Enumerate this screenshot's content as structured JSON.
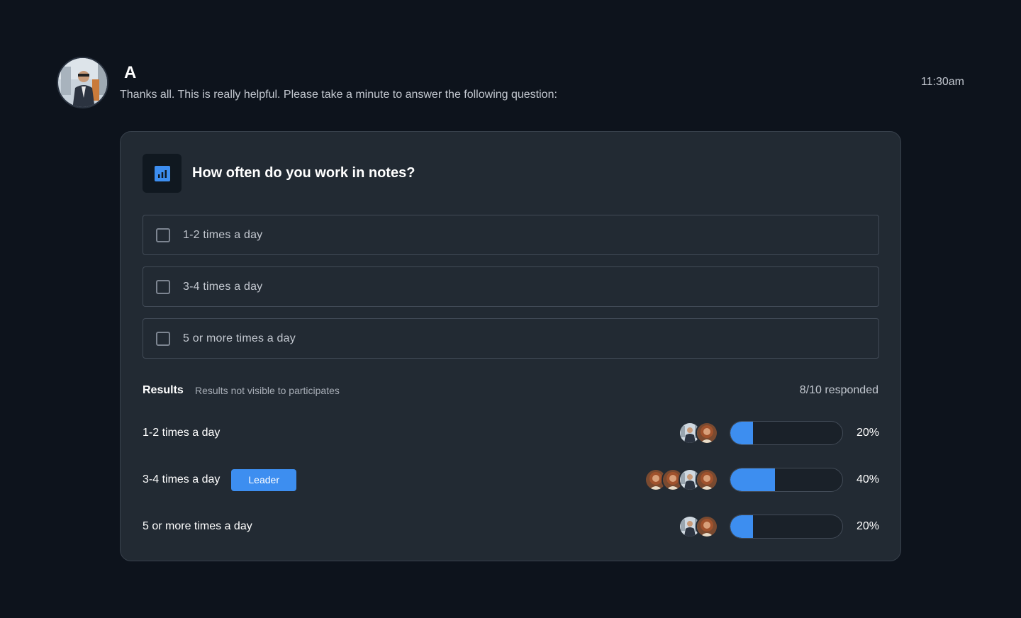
{
  "message": {
    "sender": "A",
    "text": "Thanks all. This is really helpful. Please take a minute to answer the following question:",
    "time": "11:30am"
  },
  "poll": {
    "icon": "bar-chart-icon",
    "question": "How often do you work in notes?",
    "options": [
      {
        "label": "1-2 times a day",
        "checked": false
      },
      {
        "label": "3-4 times a day",
        "checked": false
      },
      {
        "label": "5 or more times a day",
        "checked": false
      }
    ],
    "results": {
      "title": "Results",
      "note": "Results not visible to participates",
      "responded": "8/10 responded",
      "rows": [
        {
          "label": "1-2 times a day",
          "percent": 20,
          "percent_label": "20%",
          "leader": false,
          "voters": [
            "man",
            "woman"
          ]
        },
        {
          "label": "3-4 times a day",
          "percent": 40,
          "percent_label": "40%",
          "leader": true,
          "leader_label": "Leader",
          "voters": [
            "woman",
            "woman",
            "man",
            "woman"
          ]
        },
        {
          "label": "5 or more times a day",
          "percent": 20,
          "percent_label": "20%",
          "leader": false,
          "voters": [
            "man",
            "woman"
          ]
        }
      ]
    }
  },
  "colors": {
    "background": "#0d131c",
    "card": "#222a33",
    "accent": "#3d8ef0"
  }
}
